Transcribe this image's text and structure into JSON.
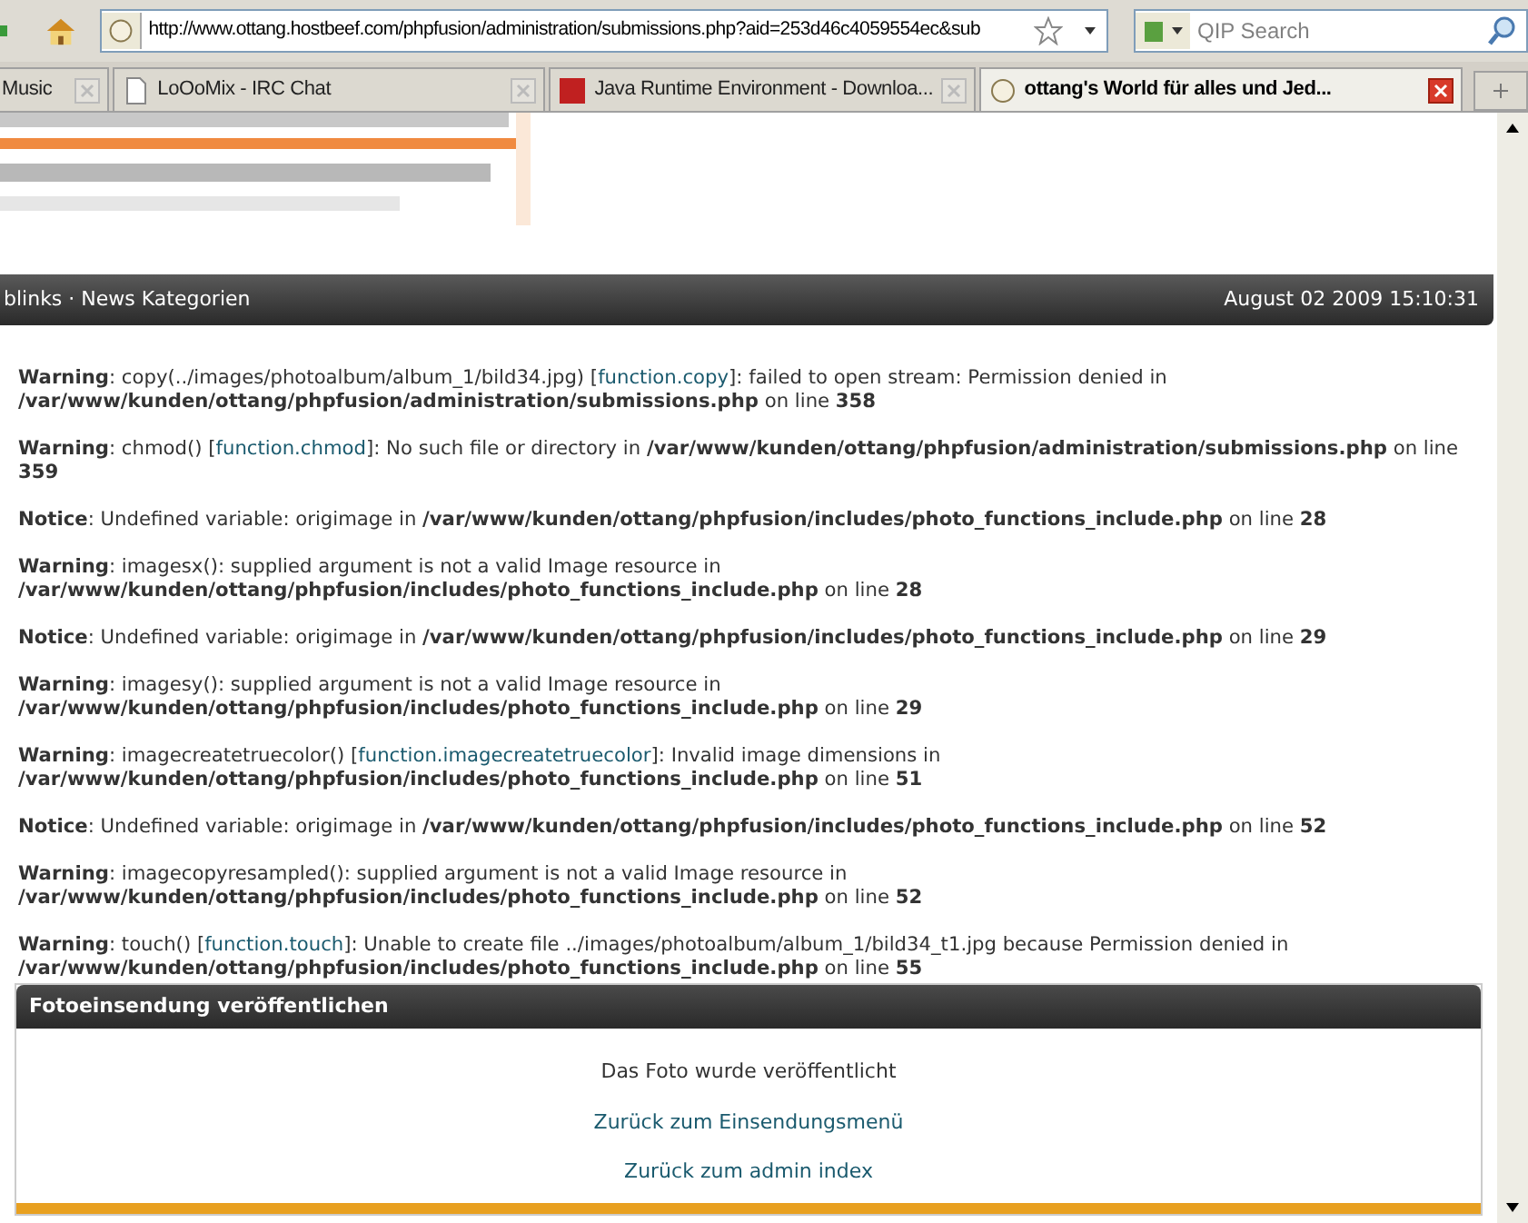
{
  "toolbar": {
    "url": "http://www.ottang.hostbeef.com/phpfusion/administration/submissions.php?aid=253d46c4059554ec&sub",
    "search": {
      "placeholder": "QIP Search"
    }
  },
  "tabs": [
    {
      "label": "Music",
      "selected": false
    },
    {
      "label": "LoOoMix - IRC Chat",
      "selected": false
    },
    {
      "label": "Java Runtime Environment - Downloa...",
      "selected": false
    },
    {
      "label": "ottang's World für alles und Jed...",
      "selected": true
    }
  ],
  "page": {
    "navbar": {
      "links": "blinks · News Kategorien",
      "date": "August 02 2009 15:10:31"
    },
    "messages": [
      {
        "level": "Warning",
        "parts": [
          {
            "kind": "text",
            "text": ": copy(../images/photoalbum/album_1/bild34.jpg) ["
          },
          {
            "kind": "link",
            "text": "function.copy"
          },
          {
            "kind": "text",
            "text": "]: failed to open stream: Permission denied in "
          },
          {
            "kind": "bold",
            "text": "/var/www/kunden/ottang/phpfusion/administration/submissions.php"
          },
          {
            "kind": "text",
            "text": " on line "
          },
          {
            "kind": "bold",
            "text": "358"
          }
        ]
      },
      {
        "level": "Warning",
        "parts": [
          {
            "kind": "text",
            "text": ": chmod() ["
          },
          {
            "kind": "link",
            "text": "function.chmod"
          },
          {
            "kind": "text",
            "text": "]: No such file or directory in "
          },
          {
            "kind": "bold",
            "text": "/var/www/kunden/ottang/phpfusion/administration/submissions.php"
          },
          {
            "kind": "text",
            "text": " on line "
          },
          {
            "kind": "bold",
            "text": "359"
          }
        ]
      },
      {
        "level": "Notice",
        "parts": [
          {
            "kind": "text",
            "text": ": Undefined variable: origimage in "
          },
          {
            "kind": "bold",
            "text": "/var/www/kunden/ottang/phpfusion/includes/photo_functions_include.php"
          },
          {
            "kind": "text",
            "text": " on line "
          },
          {
            "kind": "bold",
            "text": "28"
          }
        ]
      },
      {
        "level": "Warning",
        "parts": [
          {
            "kind": "text",
            "text": ": imagesx(): supplied argument is not a valid Image resource in "
          },
          {
            "kind": "bold",
            "text": "/var/www/kunden/ottang/phpfusion/includes/photo_functions_include.php"
          },
          {
            "kind": "text",
            "text": " on line "
          },
          {
            "kind": "bold",
            "text": "28"
          }
        ]
      },
      {
        "level": "Notice",
        "parts": [
          {
            "kind": "text",
            "text": ": Undefined variable: origimage in "
          },
          {
            "kind": "bold",
            "text": "/var/www/kunden/ottang/phpfusion/includes/photo_functions_include.php"
          },
          {
            "kind": "text",
            "text": " on line "
          },
          {
            "kind": "bold",
            "text": "29"
          }
        ]
      },
      {
        "level": "Warning",
        "parts": [
          {
            "kind": "text",
            "text": ": imagesy(): supplied argument is not a valid Image resource in "
          },
          {
            "kind": "bold",
            "text": "/var/www/kunden/ottang/phpfusion/includes/photo_functions_include.php"
          },
          {
            "kind": "text",
            "text": " on line "
          },
          {
            "kind": "bold",
            "text": "29"
          }
        ]
      },
      {
        "level": "Warning",
        "parts": [
          {
            "kind": "text",
            "text": ": imagecreatetruecolor() ["
          },
          {
            "kind": "link",
            "text": "function.imagecreatetruecolor"
          },
          {
            "kind": "text",
            "text": "]: Invalid image dimensions in "
          },
          {
            "kind": "bold",
            "text": "/var/www/kunden/ottang/phpfusion/includes/photo_functions_include.php"
          },
          {
            "kind": "text",
            "text": " on line "
          },
          {
            "kind": "bold",
            "text": "51"
          }
        ]
      },
      {
        "level": "Notice",
        "parts": [
          {
            "kind": "text",
            "text": ": Undefined variable: origimage in "
          },
          {
            "kind": "bold",
            "text": "/var/www/kunden/ottang/phpfusion/includes/photo_functions_include.php"
          },
          {
            "kind": "text",
            "text": " on line "
          },
          {
            "kind": "bold",
            "text": "52"
          }
        ]
      },
      {
        "level": "Warning",
        "parts": [
          {
            "kind": "text",
            "text": ": imagecopyresampled(): supplied argument is not a valid Image resource in "
          },
          {
            "kind": "bold",
            "text": "/var/www/kunden/ottang/phpfusion/includes/photo_functions_include.php"
          },
          {
            "kind": "text",
            "text": " on line "
          },
          {
            "kind": "bold",
            "text": "52"
          }
        ]
      },
      {
        "level": "Warning",
        "parts": [
          {
            "kind": "text",
            "text": ": touch() ["
          },
          {
            "kind": "link",
            "text": "function.touch"
          },
          {
            "kind": "text",
            "text": "]: Unable to create file ../images/photoalbum/album_1/bild34_t1.jpg because Permission denied in "
          },
          {
            "kind": "bold",
            "text": "/var/www/kunden/ottang/phpfusion/includes/photo_functions_include.php"
          },
          {
            "kind": "text",
            "text": " on line "
          },
          {
            "kind": "bold",
            "text": "55"
          }
        ]
      }
    ],
    "panel": {
      "title": "Fotoeinsendung veröffentlichen",
      "message": "Das Foto wurde veröffentlicht",
      "links": [
        "Zurück zum Einsendungsmenü",
        "Zurück zum admin index"
      ]
    }
  }
}
